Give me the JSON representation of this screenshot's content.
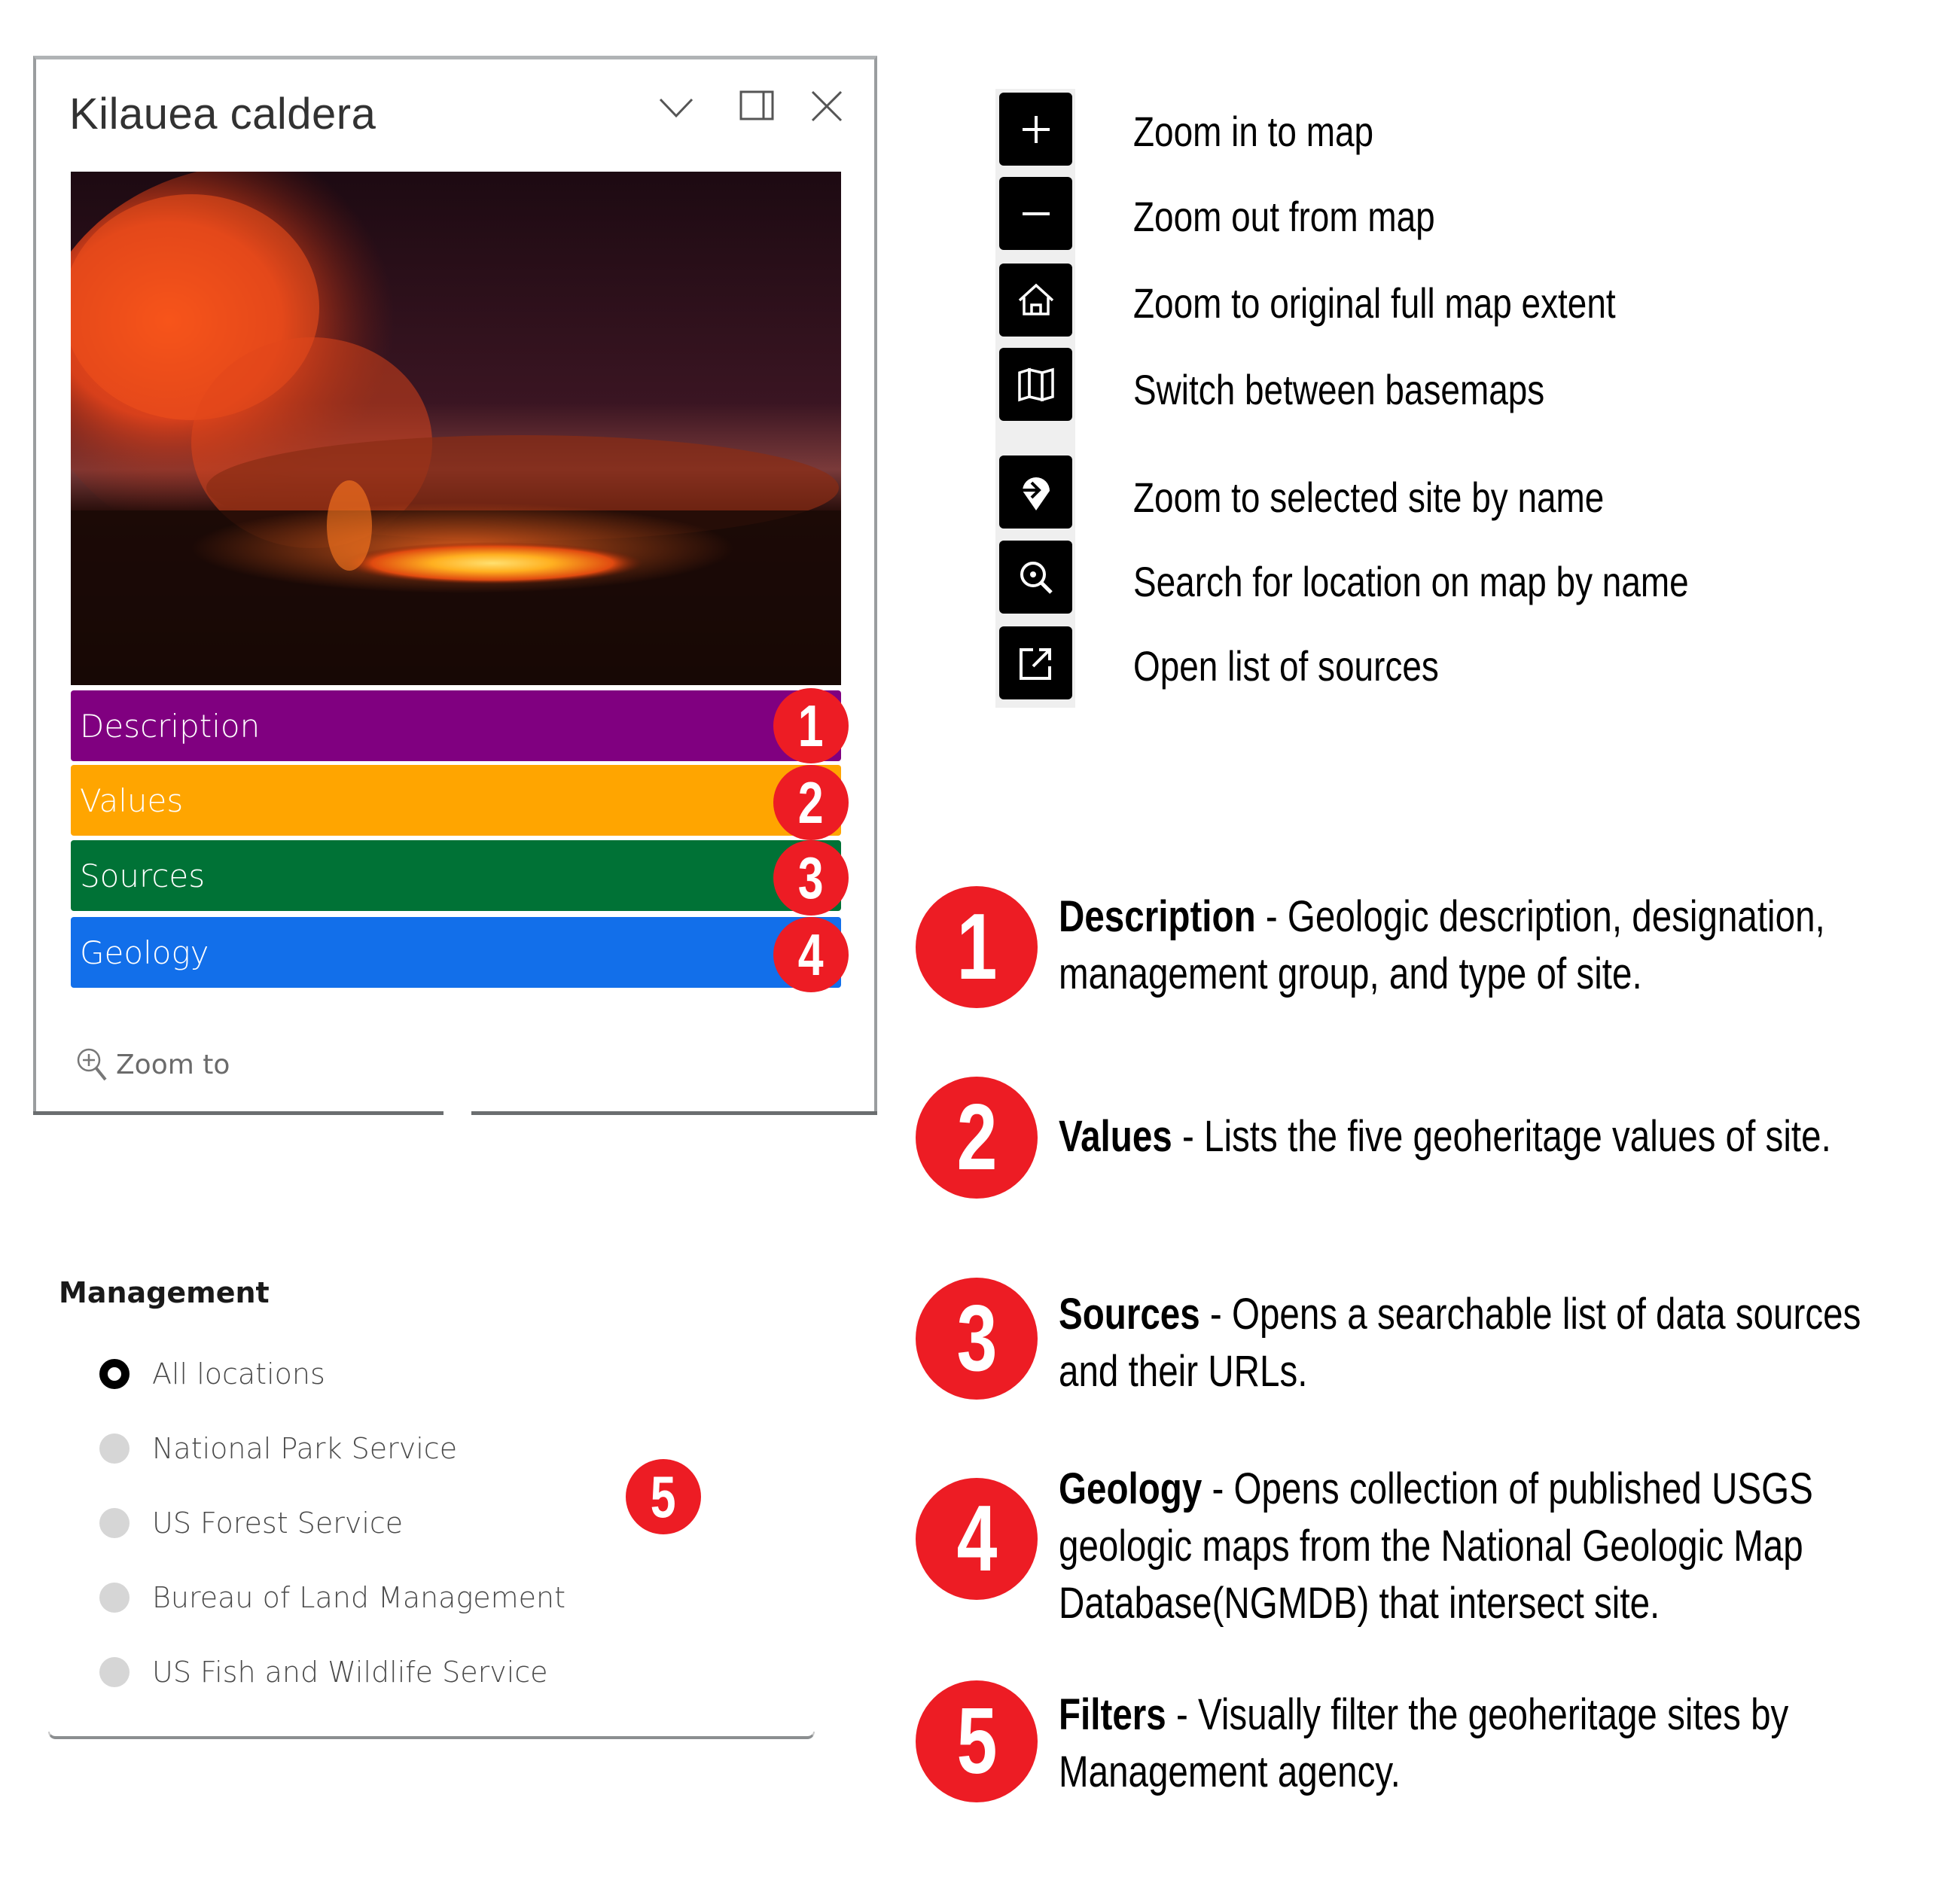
{
  "popup": {
    "title": "Kilauea caldera",
    "header_icons": [
      "chevron-down-icon",
      "dock-icon",
      "close-icon"
    ],
    "photo_alt": "Lava lake glowing in Kilauea caldera at night with orange plume",
    "sections": [
      {
        "label": "Description",
        "color": "#800080",
        "badge": "1"
      },
      {
        "label": "Values",
        "color": "#ffa500",
        "badge": "2"
      },
      {
        "label": "Sources",
        "color": "#007236",
        "badge": "3"
      },
      {
        "label": "Geology",
        "color": "#126fea",
        "badge": "4"
      }
    ],
    "zoom_to_label": "Zoom to"
  },
  "toolbar": {
    "items": [
      {
        "icon": "plus-icon",
        "label": "Zoom in to map"
      },
      {
        "icon": "minus-icon",
        "label": "Zoom out from map"
      },
      {
        "icon": "home-icon",
        "label": "Zoom to original full map extent"
      },
      {
        "icon": "basemap-icon",
        "label": "Switch between basemaps"
      },
      {
        "icon": "locate-site-icon",
        "label": "Zoom to selected site by name"
      },
      {
        "icon": "search-icon",
        "label": "Search for location on map by name"
      },
      {
        "icon": "external-link-icon",
        "label": "Open list of sources"
      }
    ]
  },
  "legend": {
    "items": [
      {
        "number": "1",
        "term": "Description",
        "separator": " - ",
        "text": "Geologic description, designation, management group, and type of site."
      },
      {
        "number": "2",
        "term": "Values",
        "separator": " - ",
        "text": "Lists the five geoheritage values of site."
      },
      {
        "number": "3",
        "term": "Sources",
        "separator": " - ",
        "text": "Opens a searchable list of data sources and their URLs."
      },
      {
        "number": "4",
        "term": "Geology",
        "separator": " - ",
        "text": "Opens collection of published USGS geologic maps from the National Geologic Map Database(NGMDB) that intersect site."
      },
      {
        "number": "5",
        "term": "Filters",
        "separator": " - ",
        "text": "Visually filter the geoheritage sites by Management agency."
      }
    ]
  },
  "filter": {
    "heading": "Management",
    "badge": "5",
    "options": [
      {
        "label": "All locations",
        "checked": true
      },
      {
        "label": "National Park Service",
        "checked": false
      },
      {
        "label": "US Forest Service",
        "checked": false
      },
      {
        "label": "Bureau of Land Management",
        "checked": false
      },
      {
        "label": "US Fish and Wildlife Service",
        "checked": false
      }
    ]
  },
  "colors": {
    "badge_red": "#ed1c24",
    "toolbar_button": "#000000"
  }
}
